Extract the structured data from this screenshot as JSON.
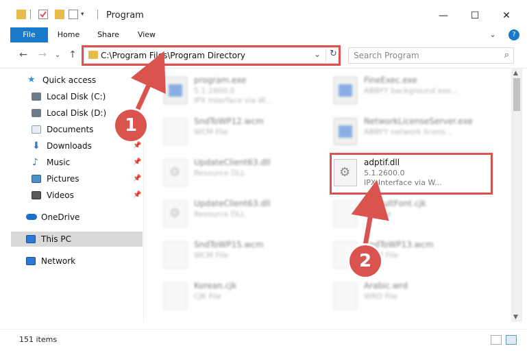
{
  "window": {
    "title": "Program",
    "controls": {
      "minimize": "—",
      "maximize": "☐",
      "close": "✕"
    }
  },
  "ribbon": {
    "tabs": [
      "File",
      "Home",
      "Share",
      "View"
    ],
    "help": "?"
  },
  "nav": {
    "back": "←",
    "forward": "→",
    "recent": "⌄",
    "up": "↑"
  },
  "address": {
    "path": "C:\\Program Files\\Program Directory",
    "dropdown": "⌄",
    "refresh": "↻"
  },
  "search": {
    "placeholder": "Search Program",
    "icon": "⌕"
  },
  "sidebar": {
    "items": [
      {
        "label": "Quick access",
        "icon": "star-icon",
        "color": "#3a8fdc"
      },
      {
        "label": "Local Disk (C:)",
        "icon": "drive-icon",
        "color": "#6d7a87"
      },
      {
        "label": "Local Disk (D:)",
        "icon": "drive-icon",
        "color": "#6d7a87"
      },
      {
        "label": "Documents",
        "icon": "document-icon",
        "color": "#8aa0b8"
      },
      {
        "label": "Downloads",
        "icon": "download-icon",
        "color": "#2f79d6"
      },
      {
        "label": "Music",
        "icon": "music-icon",
        "color": "#2f79d6"
      },
      {
        "label": "Pictures",
        "icon": "picture-icon",
        "color": "#4d8fc8"
      },
      {
        "label": "Videos",
        "icon": "video-icon",
        "color": "#5a5a5a"
      },
      {
        "label": "OneDrive",
        "icon": "cloud-icon",
        "color": "#1e6fc9"
      },
      {
        "label": "This PC",
        "icon": "computer-icon",
        "color": "#2f79d6"
      },
      {
        "label": "Network",
        "icon": "network-icon",
        "color": "#2f79d6"
      }
    ],
    "pin_glyph": "📌"
  },
  "files": {
    "left": [
      {
        "name": "program.exe",
        "line1": "5.1.2600.0",
        "line2": "IPX Interface via W..."
      },
      {
        "name": "SndToWP12.wcm",
        "line1": "WCM File",
        "line2": ""
      },
      {
        "name": "UpdateClient63.dll",
        "line1": "Resource DLL",
        "line2": ""
      },
      {
        "name": "UpdateClient63.dll",
        "line1": "Resource DLL",
        "line2": ""
      },
      {
        "name": "SndToWP15.wcm",
        "line1": "WCM File",
        "line2": ""
      },
      {
        "name": "Korean.cjk",
        "line1": "CJK File",
        "line2": ""
      }
    ],
    "right": [
      {
        "name": "FineExec.exe",
        "line1": "ABBYY background exe...",
        "line2": ""
      },
      {
        "name": "NetworkLicenseServer.exe",
        "line1": "ABBYY network licens...",
        "line2": ""
      },
      {
        "name": "adptif.dll",
        "line1": "5.1.2600.0",
        "line2": "IPX Interface via W..."
      },
      {
        "name": "DefaultFont.cjk",
        "line1": "CJK File",
        "line2": ""
      },
      {
        "name": "SndToWP13.wcm",
        "line1": "WCM File",
        "line2": ""
      },
      {
        "name": "Arabic.wrd",
        "line1": "WRD File",
        "line2": ""
      }
    ]
  },
  "status": {
    "count": "151 items"
  },
  "annotations": {
    "step1": "1",
    "step2": "2",
    "color": "#d9534f"
  }
}
